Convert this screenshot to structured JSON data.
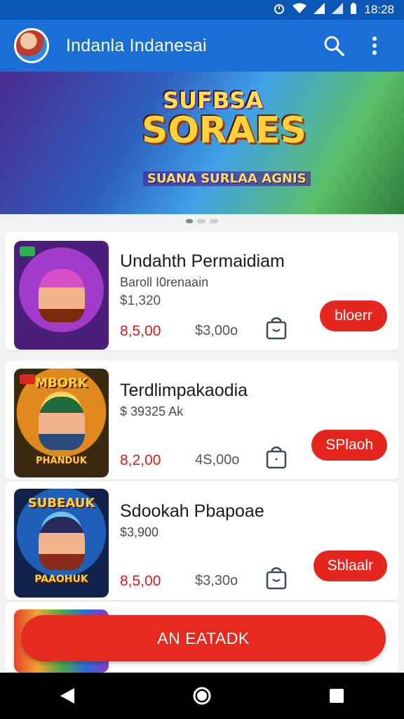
{
  "status_bar": {
    "time": "18:28"
  },
  "app_bar": {
    "title": "Indanla Indanesai"
  },
  "banner": {
    "line1": "SUFBSA",
    "line2": "SORAES",
    "line3": "SUANA SURLAA AGNIS"
  },
  "products": [
    {
      "title": "Undahth Permaidiam",
      "subtitle": "Baroll I0renaain",
      "price_small": "$1,320",
      "price_red": "8,5,00",
      "price_old": "$3,00o",
      "button": "bloerr",
      "thumb_label": ""
    },
    {
      "title": "Terdlimpakaodia",
      "subtitle": "$ 39325 Ak",
      "price_small": "",
      "price_red": "8,2,00",
      "price_old": "4S,00o",
      "button": "SPlaoh",
      "thumb_label": "MBORK"
    },
    {
      "title": "Sdookah Pbapoae",
      "subtitle": "$3,900",
      "price_small": "",
      "price_red": "8,5,00",
      "price_old": "$3,30o",
      "button": "Sblaalr",
      "thumb_label": "SUBEAUK"
    }
  ],
  "thumb_bottom_labels": [
    "",
    "PHANDUK",
    "PAAOHUK"
  ],
  "cta": {
    "label": "AN EATADK"
  },
  "colors": {
    "app_bar": "#1a6fd6",
    "status_bar": "#0b57b8",
    "accent_red": "#e5261f",
    "price_red": "#d81b1b"
  },
  "icons": [
    "search-icon",
    "more-vert-icon",
    "shopping-bag-icon",
    "back-icon",
    "home-icon",
    "recents-icon"
  ]
}
